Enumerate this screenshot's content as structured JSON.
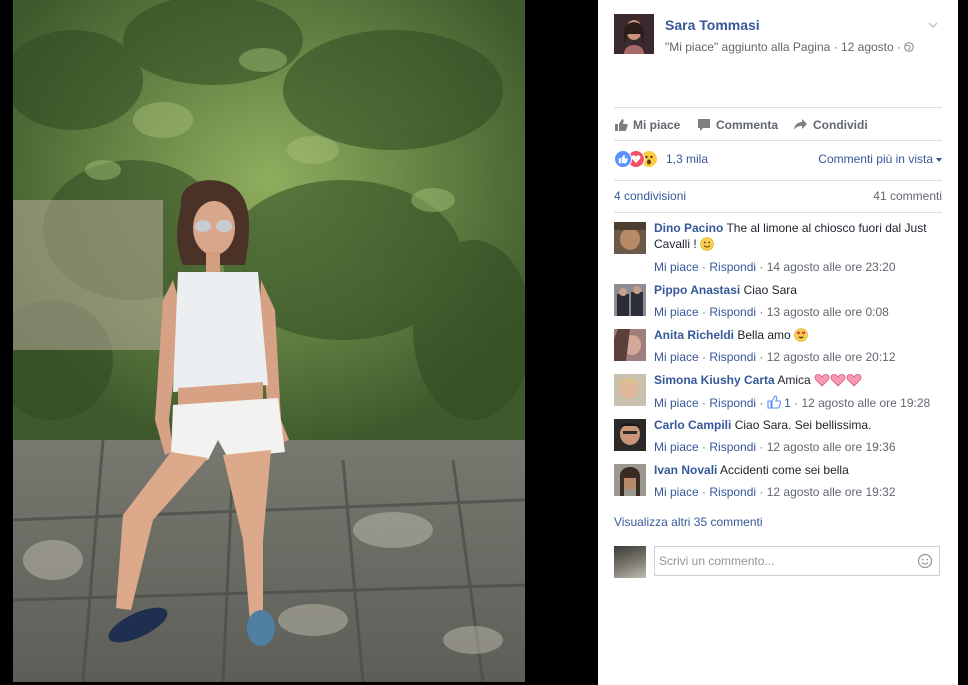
{
  "post": {
    "author": "Sara Tommasi",
    "subtitle": "\"Mi piace\" aggiunto alla Pagina · 12 agosto · ",
    "globe_icon": "globe-icon"
  },
  "actions": {
    "like": "Mi piace",
    "comment": "Commenta",
    "share": "Condividi"
  },
  "reactions": {
    "icons": [
      "like-icon",
      "love-icon",
      "wow-icon"
    ],
    "count": "1,3 mila",
    "sort_label": "Commenti più in vista"
  },
  "stats": {
    "shares": "4 condivisioni",
    "comments": "41 commenti"
  },
  "comments": [
    {
      "name": "Dino Pacino",
      "text": "The al limone al chiosco fuori dal Just Cavalli !",
      "emoji": "smile-emoji",
      "like": "Mi piace",
      "reply": "Rispondi",
      "likes": "",
      "time": "14 agosto alle ore 23:20"
    },
    {
      "name": "Pippo Anastasi",
      "text": "Ciao Sara",
      "emoji": "",
      "like": "Mi piace",
      "reply": "Rispondi",
      "likes": "",
      "time": "13 agosto alle ore 0:08"
    },
    {
      "name": "Anita Richeldi",
      "text": "Bella amo",
      "emoji": "heart-eyes-emoji",
      "like": "Mi piace",
      "reply": "Rispondi",
      "likes": "",
      "time": "12 agosto alle ore 20:12"
    },
    {
      "name": "Simona Kiushy Carta",
      "text": "Amica",
      "emoji": "sparkling-heart-emoji",
      "like": "Mi piace",
      "reply": "Rispondi",
      "likes": "1",
      "time": "12 agosto alle ore 19:28"
    },
    {
      "name": "Carlo Campili",
      "text": "Ciao Sara. Sei bellissima.",
      "emoji": "",
      "like": "Mi piace",
      "reply": "Rispondi",
      "likes": "",
      "time": "12 agosto alle ore 19:36"
    },
    {
      "name": "Ivan Novali",
      "text": "Accidenti come sei bella",
      "emoji": "",
      "like": "Mi piace",
      "reply": "Rispondi",
      "likes": "",
      "time": "12 agosto alle ore 19:32"
    }
  ],
  "more_comments": "Visualizza altri 35 commenti",
  "reply": {
    "placeholder": "Scrivi un commento..."
  },
  "colors": {
    "link": "#365899",
    "muted": "#616770",
    "like_blue": "#5890ff",
    "love_red": "#f25268",
    "wow_yellow": "#fbcd45"
  }
}
